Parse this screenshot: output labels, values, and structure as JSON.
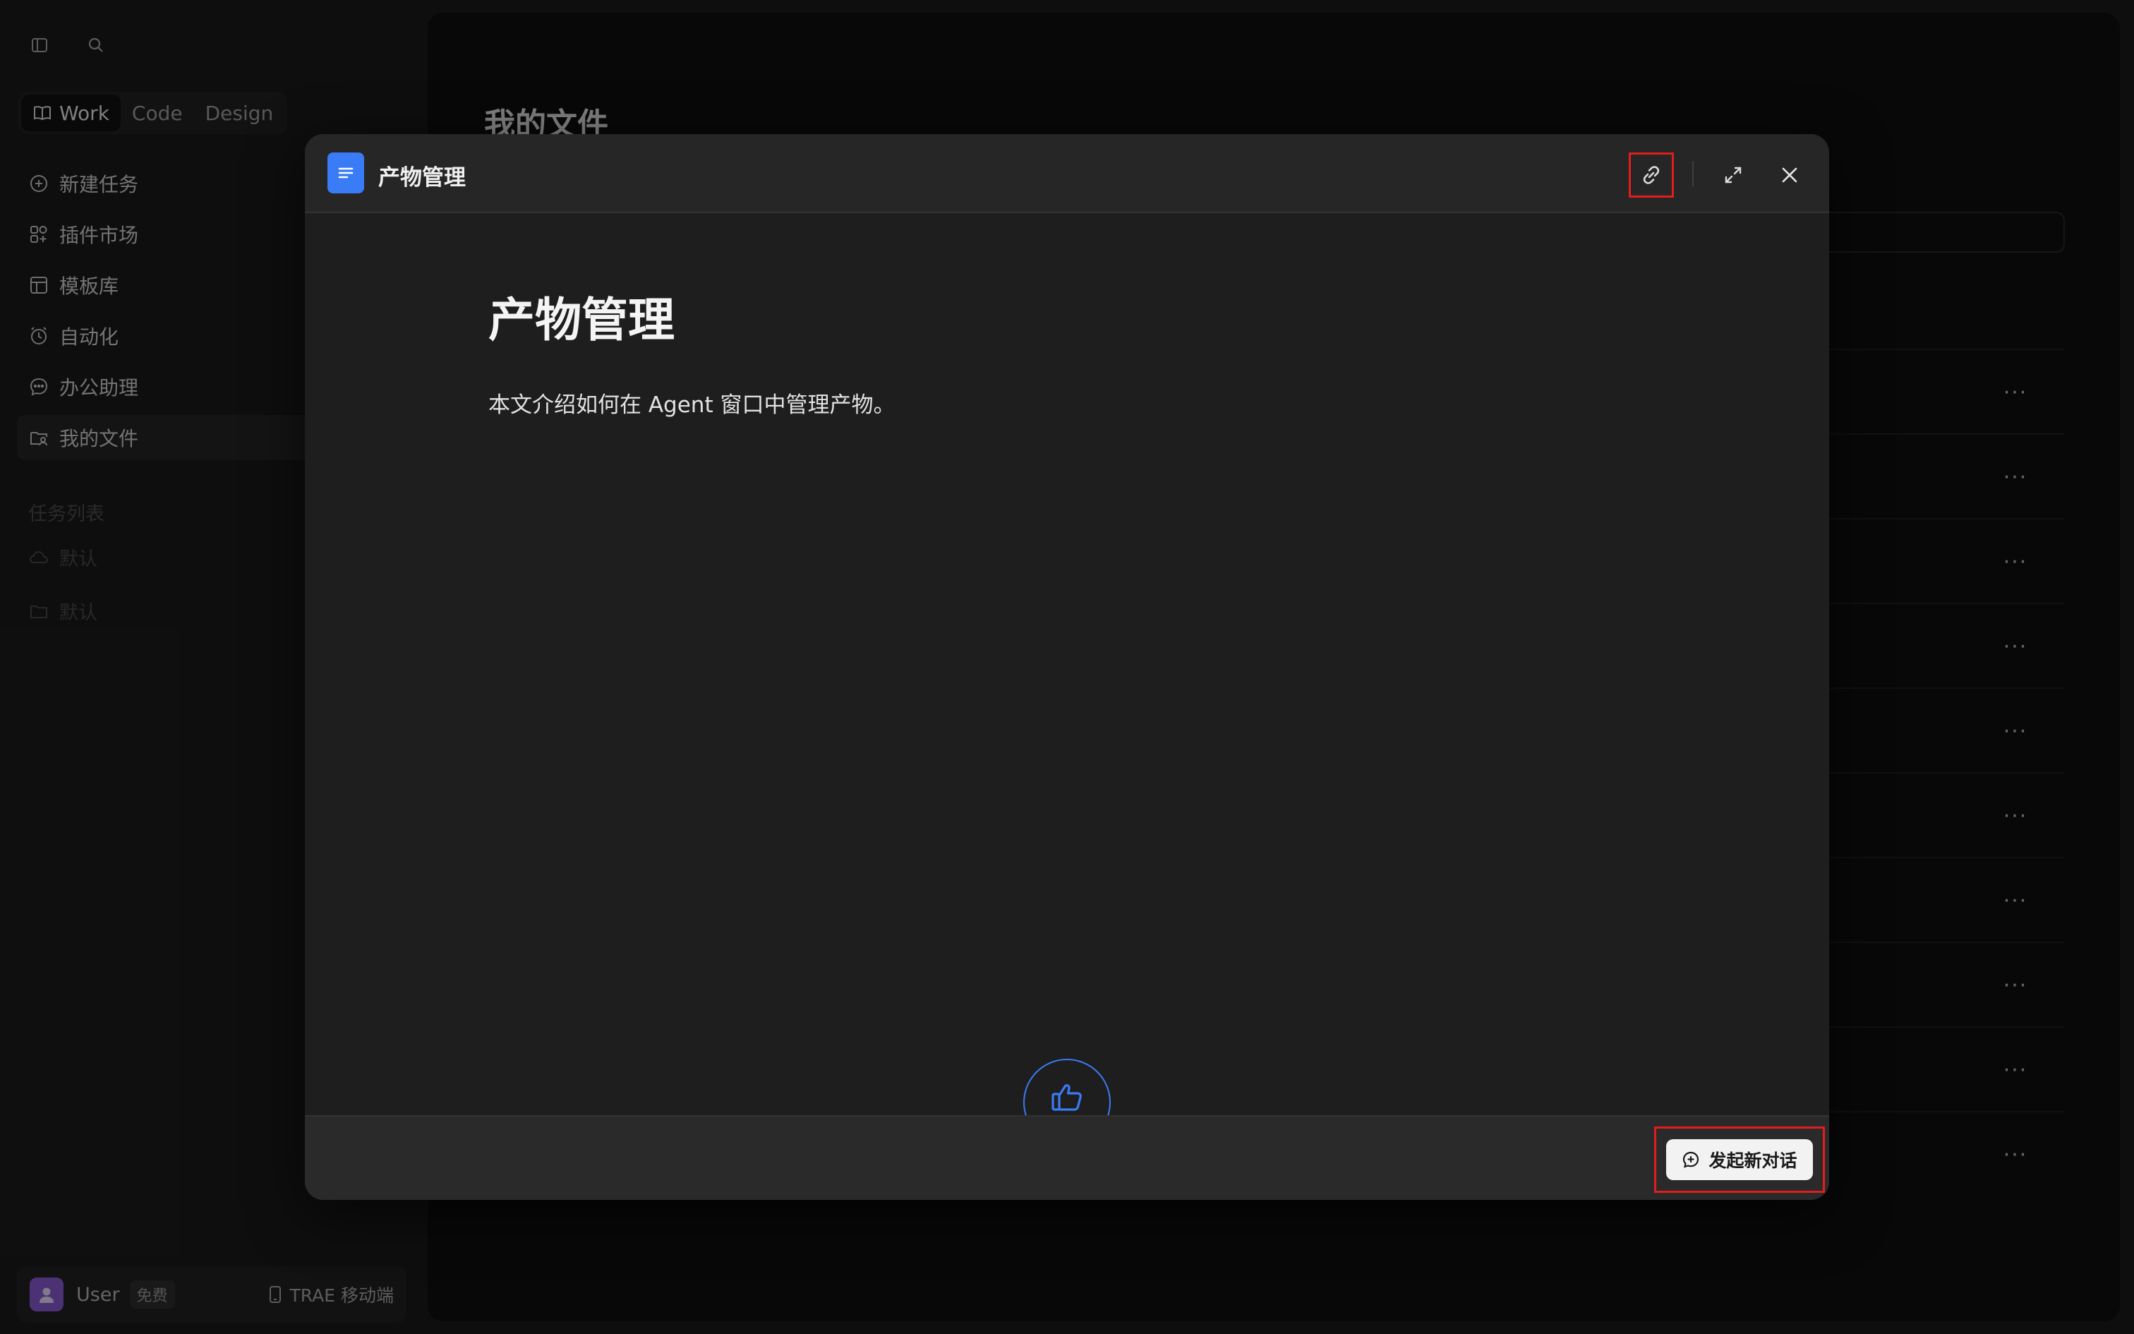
{
  "sidebar": {
    "modes": [
      {
        "label": "Work",
        "icon": "book-icon",
        "active": true
      },
      {
        "label": "Code"
      },
      {
        "label": "Design"
      }
    ],
    "nav": [
      {
        "label": "新建任务",
        "icon": "plus-circle-icon"
      },
      {
        "label": "插件市场",
        "icon": "apps-icon"
      },
      {
        "label": "模板库",
        "icon": "template-icon"
      },
      {
        "label": "自动化",
        "icon": "clock-icon"
      },
      {
        "label": "办公助理",
        "icon": "chat-icon"
      },
      {
        "label": "我的文件",
        "icon": "folder-user-icon",
        "active": true
      }
    ],
    "task_section_label": "任务列表",
    "tasks": [
      {
        "label": "默认",
        "icon": "cloud-icon"
      },
      {
        "label": "默认",
        "icon": "folder-icon"
      }
    ],
    "user": {
      "name": "User",
      "plan": "免费",
      "mobile_link": "TRAE 移动端"
    }
  },
  "main": {
    "title": "我的文件",
    "row_count": 10,
    "more_label": "···"
  },
  "modal": {
    "title": "产物管理",
    "doc_heading": "产物管理",
    "doc_text": "本文介绍如何在 Agent 窗口中管理产物。",
    "new_chat_label": "发起新对话"
  },
  "colors": {
    "accent_blue": "#3a7bf6",
    "highlight_red": "#e21d1d",
    "avatar_purple": "#8b5cd6"
  }
}
